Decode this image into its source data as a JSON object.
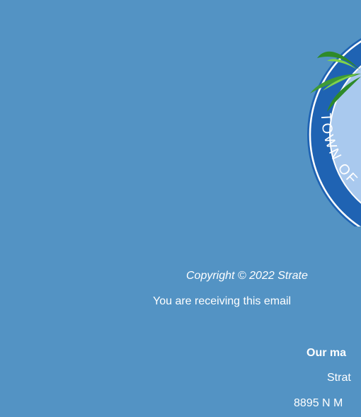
{
  "seal": {
    "icon": "town-seal-logo",
    "text": "TOWN OF",
    "colors": {
      "outer_ring": "#1f63b3",
      "inner_field": "#a9c9ee",
      "white_rim": "#ffffff",
      "palm_dark": "#2e8a2a",
      "palm_light": "#7fd24a"
    }
  },
  "footer": {
    "copyright": "Copyright © 2022 Strate",
    "receiving": "You are receiving this email",
    "mailing_label": "Our ma",
    "org_name": "Strat",
    "street": "8895 N M"
  },
  "colors": {
    "background": "#5393c4",
    "text": "#ffffff"
  }
}
